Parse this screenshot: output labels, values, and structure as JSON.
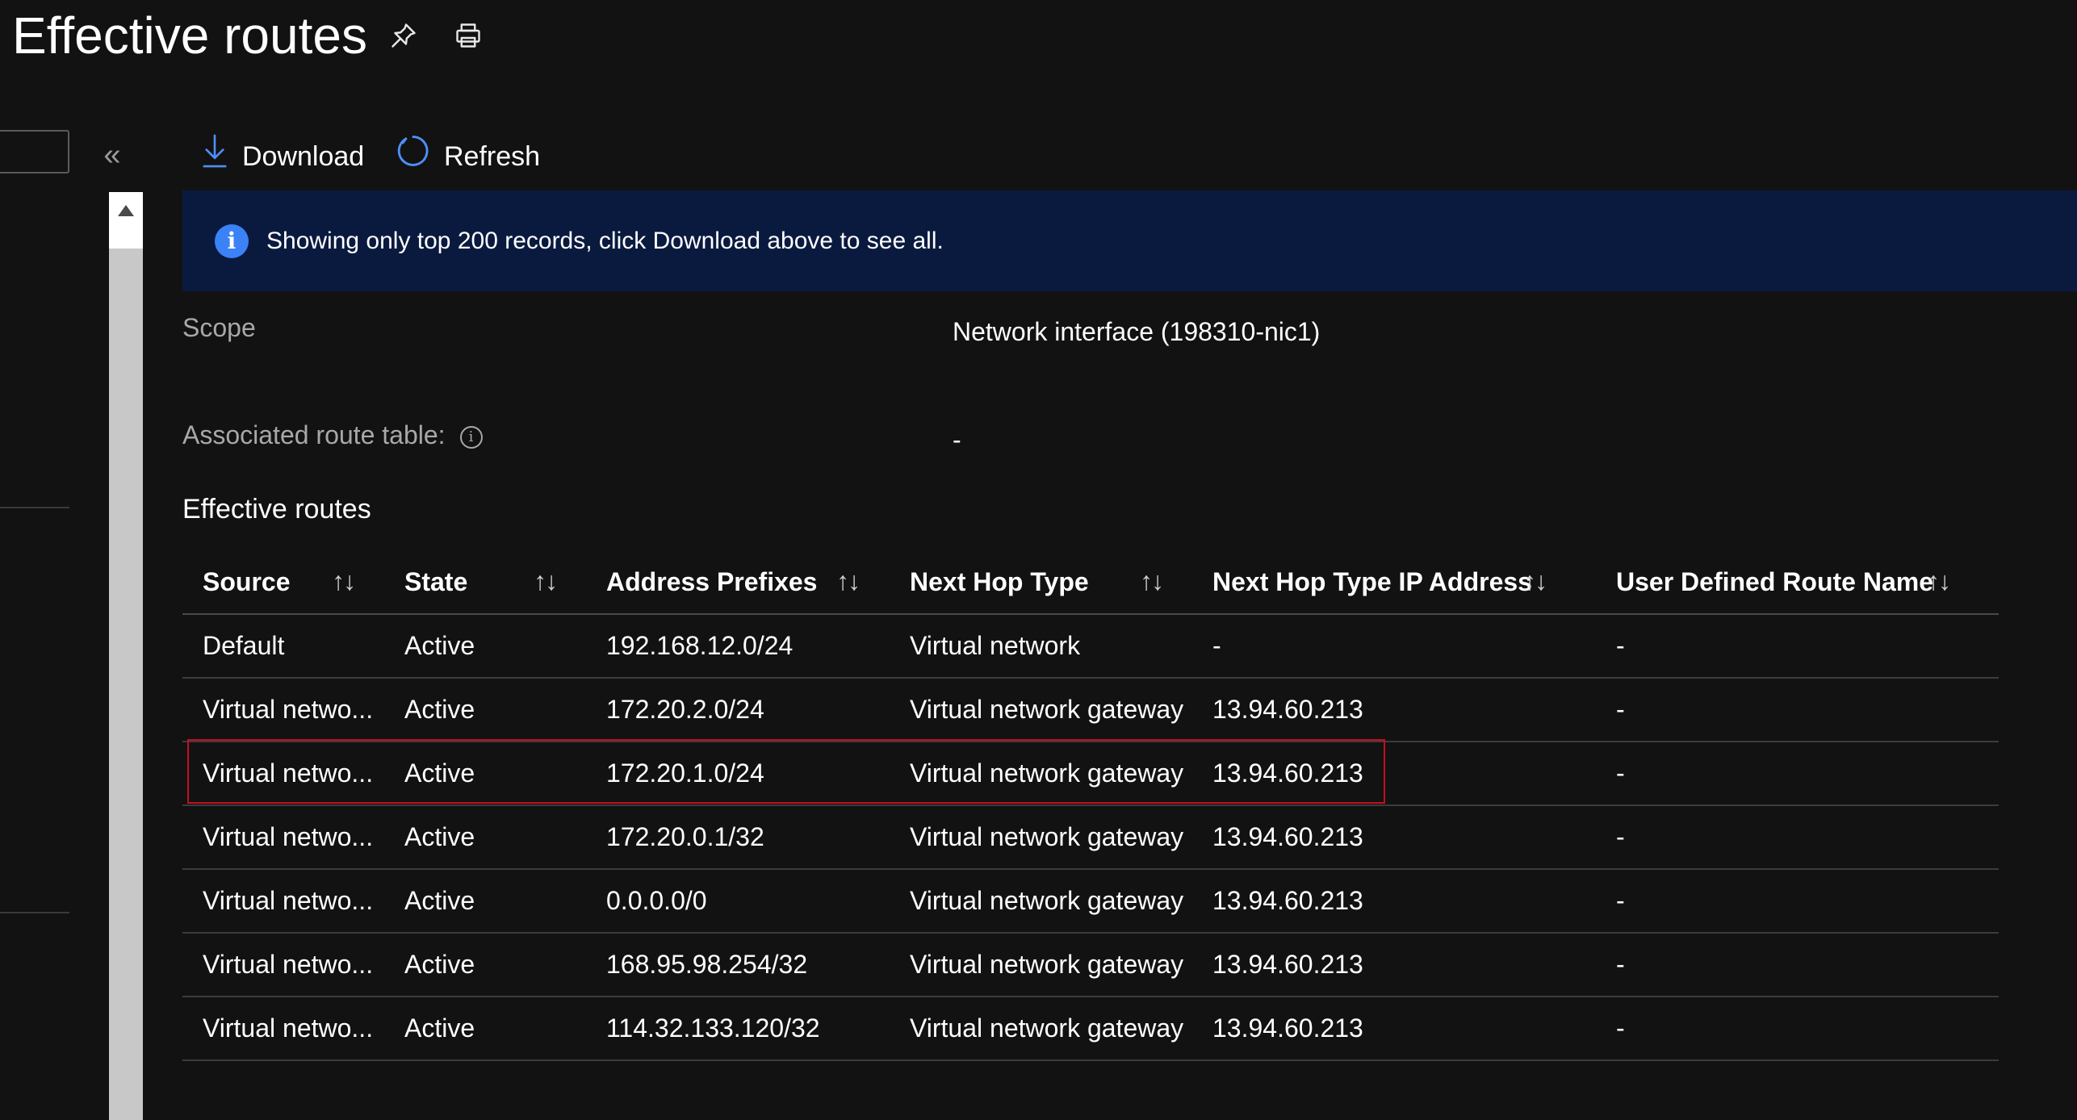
{
  "header": {
    "title": "Effective routes",
    "pin_icon": "pin-icon",
    "print_icon": "print-icon"
  },
  "sidebar": {
    "collapse_glyph": "«",
    "search_value": ""
  },
  "toolbar": {
    "download_label": "Download",
    "refresh_label": "Refresh"
  },
  "banner": {
    "text": "Showing only top 200 records, click Download above to see all.",
    "icon_glyph": "i"
  },
  "details": {
    "scope_label": "Scope",
    "scope_value": "Network interface (198310-nic1)",
    "route_table_label": "Associated route table:",
    "route_table_value": "-",
    "info_glyph": "i"
  },
  "routes": {
    "title": "Effective routes",
    "sort_glyph": "↑↓",
    "columns": [
      "Source",
      "State",
      "Address Prefixes",
      "Next Hop Type",
      "Next Hop Type IP Address",
      "User Defined Route Name"
    ],
    "rows": [
      [
        "Default",
        "Active",
        "192.168.12.0/24",
        "Virtual network",
        "-",
        "-"
      ],
      [
        "Virtual netwo...",
        "Active",
        "172.20.2.0/24",
        "Virtual network gateway",
        "13.94.60.213",
        "-"
      ],
      [
        "Virtual netwo...",
        "Active",
        "172.20.1.0/24",
        "Virtual network gateway",
        "13.94.60.213",
        "-"
      ],
      [
        "Virtual netwo...",
        "Active",
        "172.20.0.1/32",
        "Virtual network gateway",
        "13.94.60.213",
        "-"
      ],
      [
        "Virtual netwo...",
        "Active",
        "0.0.0.0/0",
        "Virtual network gateway",
        "13.94.60.213",
        "-"
      ],
      [
        "Virtual netwo...",
        "Active",
        "168.95.98.254/32",
        "Virtual network gateway",
        "13.94.60.213",
        "-"
      ],
      [
        "Virtual netwo...",
        "Active",
        "114.32.133.120/32",
        "Virtual network gateway",
        "13.94.60.213",
        "-"
      ]
    ],
    "highlighted_row": 2
  },
  "colors": {
    "background": "#121212",
    "banner": "#0a1a3f",
    "accent": "#3b82f6",
    "highlight": "#c50f1f"
  }
}
